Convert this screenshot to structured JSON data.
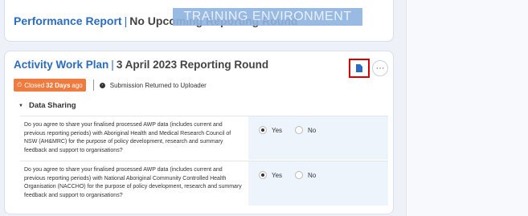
{
  "top_card": {
    "title": "Performance Report",
    "subtitle": "No Upcoming Reporting Round"
  },
  "banner": "TRAINING ENVIRONMENT",
  "card": {
    "title": "Activity Work Plan",
    "subtitle": "3 April 2023 Reporting Round",
    "status": {
      "closed_prefix": "Closed",
      "closed_days": "32 Days",
      "closed_suffix": "ago",
      "submission": "Submission Returned to Uploader"
    },
    "section": "Data Sharing",
    "questions": [
      {
        "text": "Do you agree to share your finalised processed AWP data (includes current and previous reporting periods) with Aboriginal Health and Medical Research Council of NSW (AH&MRC) for the purpose of policy development, research and summary feedback and support to organisations?",
        "yes_label": "Yes",
        "no_label": "No",
        "selected": "Yes"
      },
      {
        "text": "Do you agree to share your finalised processed AWP data (includes current and previous reporting periods) with National Aboriginal Community Controlled Health Organisation (NACCHO) for the purpose of policy development, research and summary feedback and support to organisations?",
        "yes_label": "Yes",
        "no_label": "No",
        "selected": "Yes"
      }
    ]
  },
  "icons": {
    "document": "document-icon",
    "more": "more-options-icon",
    "clock": "clock-icon",
    "caret": "caret-down-icon"
  },
  "colors": {
    "accent": "#2a6cbf",
    "closed_badge": "#f07b3f",
    "highlight_border": "#d40000"
  }
}
